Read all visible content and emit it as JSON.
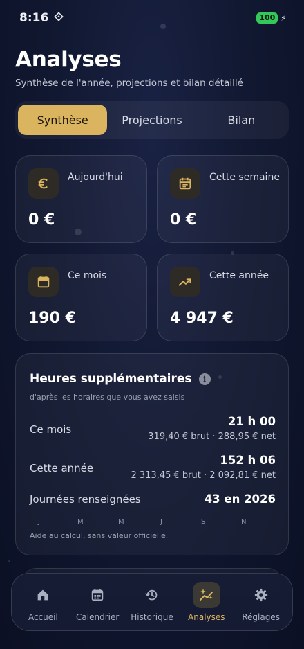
{
  "status_bar": {
    "time": "8:16",
    "battery": "100"
  },
  "header": {
    "title": "Analyses",
    "subtitle": "Synthèse de l'année, projections et bilan détaillé"
  },
  "segments": [
    {
      "label": "Synthèse",
      "active": true
    },
    {
      "label": "Projections",
      "active": false
    },
    {
      "label": "Bilan",
      "active": false
    }
  ],
  "stats": [
    {
      "label": "Aujourd'hui",
      "value": "0 €",
      "icon": "euro-icon"
    },
    {
      "label": "Cette semaine",
      "value": "0 €",
      "icon": "calendar-week-icon"
    },
    {
      "label": "Ce mois",
      "value": "190 €",
      "icon": "calendar-month-icon"
    },
    {
      "label": "Cette année",
      "value": "4 947 €",
      "icon": "trending-up-icon"
    }
  ],
  "overtime": {
    "title": "Heures supplémentaires",
    "subtitle": "d'après les horaires que vous avez saisis",
    "month": {
      "label": "Ce mois",
      "value": "21 h 00",
      "detail": "319,40 € brut · 288,95 € net"
    },
    "year": {
      "label": "Cette année",
      "value": "152 h 06",
      "detail": "2 313,45 € brut · 2 092,81 € net"
    },
    "days": {
      "label": "Journées renseignées",
      "value": "43 en 2026"
    },
    "months": [
      "J",
      "M",
      "M",
      "J",
      "S",
      "N"
    ],
    "footnote": "Aide au calcul, sans valeur officielle."
  },
  "tabs": [
    {
      "label": "Accueil",
      "icon": "home-icon"
    },
    {
      "label": "Calendrier",
      "icon": "calendar-icon"
    },
    {
      "label": "Historique",
      "icon": "history-icon"
    },
    {
      "label": "Analyses",
      "icon": "sparkle-chart-icon",
      "active": true
    },
    {
      "label": "Réglages",
      "icon": "gear-icon"
    }
  ],
  "colors": {
    "accent": "#dbb45f",
    "background": "#111831"
  }
}
